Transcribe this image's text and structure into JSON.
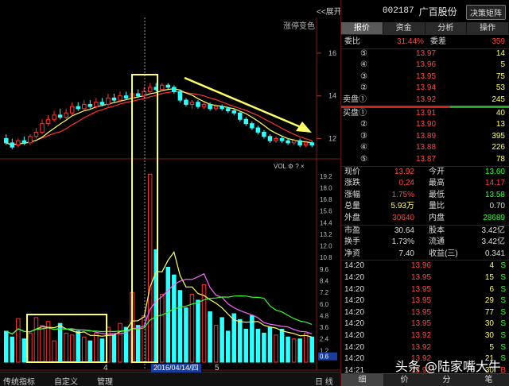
{
  "window": {
    "expand_label": "<<展开",
    "chart_mode_label": "涨停变色"
  },
  "stock": {
    "code": "002187",
    "name": "广百股份",
    "decision_btn": "决策矩阵"
  },
  "tabs": [
    "报价",
    "资金",
    "分析",
    "操作"
  ],
  "order_ratio": {
    "wb_label": "委比",
    "wb_value": "31.44%",
    "wc_label": "委差",
    "wc_value": "359"
  },
  "asks": [
    {
      "level": "⑤",
      "price": "13.97",
      "vol": "14"
    },
    {
      "level": "④",
      "price": "13.96",
      "vol": "5"
    },
    {
      "level": "③",
      "price": "13.95",
      "vol": "75"
    },
    {
      "level": "②",
      "price": "13.94",
      "vol": "53"
    },
    {
      "level": "卖盘①",
      "price": "13.92",
      "vol": "245"
    }
  ],
  "bids": [
    {
      "level": "买盘①",
      "price": "13.91",
      "vol": "40"
    },
    {
      "level": "②",
      "price": "13.90",
      "vol": "13"
    },
    {
      "level": "③",
      "price": "13.89",
      "vol": "395"
    },
    {
      "level": "④",
      "price": "13.88",
      "vol": "226"
    },
    {
      "level": "⑤",
      "price": "13.87",
      "vol": "78"
    }
  ],
  "stats": [
    {
      "l1": "现价",
      "v1": "13.92",
      "c1": "#ff4444",
      "l2": "今开",
      "v2": "13.60",
      "c2": "#33ff33"
    },
    {
      "l1": "涨跌",
      "v1": "0.24",
      "c1": "#ff4444",
      "l2": "最高",
      "v2": "14.17",
      "c2": "#ff4444"
    },
    {
      "l1": "涨幅",
      "v1": "1.75%",
      "c1": "#ff4444",
      "l2": "最低",
      "v2": "13.58",
      "c2": "#33ff33"
    },
    {
      "l1": "总量",
      "v1": "5.93万",
      "c1": "#ffff66",
      "l2": "量比",
      "v2": "0.70",
      "c2": "#dddddd"
    },
    {
      "l1": "外盘",
      "v1": "30640",
      "c1": "#ff4444",
      "l2": "内盘",
      "v2": "28689",
      "c2": "#33ff33"
    }
  ],
  "stats2": [
    {
      "l1": "市盈",
      "v1": "30.64",
      "l2": "股本",
      "v2": "3.42亿"
    },
    {
      "l1": "换手",
      "v1": "1.73%",
      "l2": "流通",
      "v2": "3.42亿"
    },
    {
      "l1": "净资",
      "v1": "7.40",
      "l2": "收益(三)",
      "v2": "0.341"
    }
  ],
  "ticks": [
    {
      "time": "14:20",
      "price": "13.96",
      "vol": "4",
      "dir": "S"
    },
    {
      "time": "14:20",
      "price": "13.95",
      "vol": "15",
      "dir": "S"
    },
    {
      "time": "14:20",
      "price": "13.95",
      "vol": "6",
      "dir": "S"
    },
    {
      "time": "14:20",
      "price": "13.95",
      "vol": "29",
      "dir": "S"
    },
    {
      "time": "14:20",
      "price": "13.95",
      "vol": "77",
      "dir": "S"
    },
    {
      "time": "14:20",
      "price": "13.95",
      "vol": "30",
      "dir": "S"
    },
    {
      "time": "14:20",
      "price": "13.92",
      "vol": "30",
      "dir": "S"
    },
    {
      "time": "14:20",
      "price": "13.92",
      "vol": "5",
      "dir": "S"
    },
    {
      "time": "14:20",
      "price": "13.92",
      "vol": "21",
      "dir": "S"
    },
    {
      "time": "14:21",
      "price": "13.92",
      "vol": "30",
      "dir": "B"
    }
  ],
  "price_axis": [
    "16",
    "14",
    "12"
  ],
  "vol_axis": [
    "19.2",
    "18.0",
    "16.8",
    "15.6",
    "14.4",
    "13.2",
    "12.0",
    "10.8",
    "9.6",
    "8.4",
    "7.2",
    "6.0",
    "4.8",
    "3.6",
    "2.4",
    "1.2",
    "0.6"
  ],
  "vol_toolbar": "VOL",
  "bottom": {
    "b1": "传统指标",
    "b2": "自定义",
    "b3": "管理",
    "x4": "4",
    "x5": "5",
    "date": "2016/04/14/四",
    "day": "日",
    "line": "线"
  },
  "bottom_tabs": [
    "细",
    "价",
    "分",
    "笔"
  ],
  "watermark": "头条 @陆家嘴大牛",
  "colors": {
    "up": "#ff3333",
    "down": "#33ffff",
    "ma5": "#ffff66",
    "ma10": "#ff66ff",
    "ma20": "#ff3333",
    "highlight": "#ffff66"
  },
  "chart_data": {
    "type": "candlestick",
    "candles": [
      [
        12.0,
        11.8,
        12.2,
        11.7,
        "down"
      ],
      [
        11.8,
        11.6,
        12.0,
        11.5,
        "down"
      ],
      [
        11.7,
        11.9,
        12.0,
        11.6,
        "up"
      ],
      [
        11.9,
        11.8,
        12.1,
        11.7,
        "down"
      ],
      [
        11.8,
        12.1,
        12.2,
        11.7,
        "up"
      ],
      [
        12.1,
        12.3,
        12.5,
        12.0,
        "up"
      ],
      [
        12.3,
        12.7,
        12.9,
        12.2,
        "up"
      ],
      [
        12.7,
        12.9,
        13.1,
        12.6,
        "up"
      ],
      [
        12.9,
        13.1,
        13.3,
        12.8,
        "up"
      ],
      [
        13.1,
        13.0,
        13.4,
        12.9,
        "down"
      ],
      [
        13.0,
        13.2,
        13.4,
        12.9,
        "up"
      ],
      [
        13.2,
        13.5,
        13.7,
        13.1,
        "up"
      ],
      [
        13.5,
        13.4,
        13.7,
        13.3,
        "down"
      ],
      [
        13.4,
        13.6,
        13.8,
        13.3,
        "up"
      ],
      [
        13.6,
        13.5,
        13.8,
        13.4,
        "down"
      ],
      [
        13.5,
        13.7,
        13.9,
        13.4,
        "up"
      ],
      [
        13.7,
        13.6,
        13.9,
        13.5,
        "down"
      ],
      [
        13.6,
        13.9,
        14.1,
        13.5,
        "up"
      ],
      [
        13.9,
        13.8,
        14.1,
        13.7,
        "down"
      ],
      [
        13.8,
        14.0,
        14.2,
        13.7,
        "up"
      ],
      [
        14.0,
        13.9,
        14.2,
        13.8,
        "down"
      ],
      [
        13.9,
        14.1,
        14.3,
        13.8,
        "up"
      ],
      [
        14.1,
        14.0,
        14.3,
        13.9,
        "down"
      ],
      [
        14.0,
        14.2,
        14.4,
        13.9,
        "up"
      ],
      [
        14.2,
        14.4,
        14.6,
        14.1,
        "up"
      ],
      [
        14.4,
        14.3,
        14.6,
        14.2,
        "down"
      ],
      [
        14.3,
        14.5,
        14.6,
        14.2,
        "up"
      ],
      [
        14.5,
        14.4,
        14.6,
        14.3,
        "down"
      ],
      [
        14.4,
        14.2,
        14.5,
        14.1,
        "down"
      ],
      [
        14.2,
        13.8,
        14.3,
        13.7,
        "down"
      ],
      [
        13.8,
        13.6,
        13.9,
        13.5,
        "down"
      ],
      [
        13.6,
        13.7,
        13.8,
        13.4,
        "up"
      ],
      [
        13.7,
        13.5,
        13.8,
        13.4,
        "down"
      ],
      [
        13.5,
        13.6,
        13.7,
        13.4,
        "up"
      ],
      [
        13.6,
        13.4,
        13.7,
        13.3,
        "down"
      ],
      [
        13.4,
        13.5,
        13.6,
        13.3,
        "up"
      ],
      [
        13.5,
        13.4,
        13.6,
        13.3,
        "down"
      ],
      [
        13.4,
        13.3,
        13.5,
        13.2,
        "down"
      ],
      [
        13.3,
        13.2,
        13.4,
        13.1,
        "down"
      ],
      [
        13.2,
        12.9,
        13.3,
        12.8,
        "down"
      ],
      [
        12.9,
        12.7,
        13.0,
        12.6,
        "down"
      ],
      [
        12.7,
        12.5,
        12.8,
        12.4,
        "down"
      ],
      [
        12.5,
        12.3,
        12.6,
        12.2,
        "down"
      ],
      [
        12.3,
        12.1,
        12.4,
        12.0,
        "down"
      ],
      [
        12.1,
        11.9,
        12.2,
        11.8,
        "down"
      ],
      [
        11.9,
        12.0,
        12.1,
        11.8,
        "up"
      ],
      [
        12.0,
        11.9,
        12.1,
        11.8,
        "down"
      ],
      [
        11.9,
        11.8,
        12.0,
        11.7,
        "down"
      ],
      [
        11.8,
        11.9,
        12.0,
        11.7,
        "up"
      ],
      [
        11.9,
        11.7,
        12.0,
        11.6,
        "down"
      ],
      [
        11.7,
        11.8,
        11.9,
        11.6,
        "up"
      ],
      [
        11.8,
        11.7,
        11.9,
        11.6,
        "down"
      ]
    ],
    "volume": [
      3.2,
      2.6,
      4.5,
      2.4,
      3.0,
      4.6,
      3.8,
      4.2,
      2.2,
      4.0,
      3.0,
      2.8,
      3.2,
      2.6,
      2.2,
      3.0,
      2.4,
      3.6,
      2.8,
      4.0,
      3.6,
      7.2,
      3.8,
      4.8,
      19.4,
      11.6,
      7.0,
      9.8,
      9.0,
      7.4,
      5.6,
      7.0,
      6.4,
      8.0,
      5.2,
      3.8,
      4.6,
      3.2,
      5.0,
      4.4,
      3.4,
      4.8,
      3.4,
      3.0,
      3.6,
      2.8,
      3.4,
      2.6,
      2.4,
      2.4,
      3.0,
      2.6
    ],
    "price_range": [
      11.2,
      17.0
    ],
    "vol_range": [
      0,
      20
    ]
  }
}
